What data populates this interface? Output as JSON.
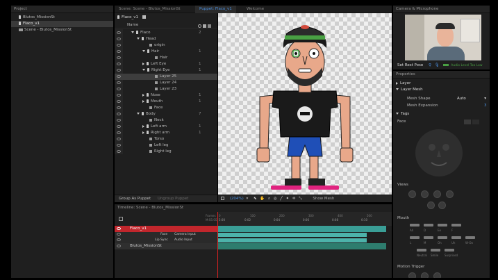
{
  "project": {
    "title": "Project",
    "items": [
      {
        "label": "Blutos_MissionSt"
      },
      {
        "label": "Flaco_v1"
      },
      {
        "label": "Scene - Blutos_MissionSt"
      }
    ]
  },
  "tabs": [
    {
      "label": "Scene: Scene - Blutos_MissionSt"
    },
    {
      "label": "Puppet: Flaco_v1"
    },
    {
      "label": "Welcome"
    }
  ],
  "puppet": {
    "name": "Flaco_v1",
    "column_name": "Name",
    "rows": [
      {
        "label": "Flaco",
        "num": "2"
      },
      {
        "label": "Head",
        "num": ""
      },
      {
        "label": "origin",
        "num": ""
      },
      {
        "label": "Hair",
        "num": "1"
      },
      {
        "label": "Hair",
        "num": ""
      },
      {
        "label": "Left Eye",
        "num": "1"
      },
      {
        "label": "Right Eye",
        "num": "1"
      },
      {
        "label": "Layer 25",
        "num": ""
      },
      {
        "label": "Layer 24",
        "num": ""
      },
      {
        "label": "Layer 23",
        "num": ""
      },
      {
        "label": "Nose",
        "num": "1"
      },
      {
        "label": "Mouth",
        "num": "1"
      },
      {
        "label": "Face",
        "num": ""
      },
      {
        "label": "Body",
        "num": "7"
      },
      {
        "label": "Neck",
        "num": ""
      },
      {
        "label": "Left arm",
        "num": "1"
      },
      {
        "label": "Right arm",
        "num": "1"
      },
      {
        "label": "Torso",
        "num": ""
      },
      {
        "label": "Left leg",
        "num": ""
      },
      {
        "label": "Right leg",
        "num": ""
      }
    ],
    "group_btn": "Group As Puppet",
    "ungroup_btn": "Ungroup Puppet",
    "zoom": "(204%)",
    "show_mesh": "Show Mesh"
  },
  "camera": {
    "title": "Camera & Microphone",
    "rest_pose": "Set Rest Pose",
    "audio_label": "Audio Level Too Low"
  },
  "properties": {
    "title": "Properties",
    "layer": "Layer",
    "layer_mesh": "Layer Mesh",
    "mesh_shape_label": "Mesh Shape",
    "mesh_shape_value": "Auto",
    "mesh_expansion_label": "Mesh Expansion",
    "mesh_expansion_value": "3",
    "tags": "Tags",
    "face": "Face",
    "views": "Views",
    "mouth": "Mouth",
    "mouth_labels": [
      "Ah",
      "D",
      "Ee",
      "F",
      "L",
      "M",
      "Oh",
      "Uh",
      "W-Oo",
      "Neutral",
      "Smile",
      "Surprised"
    ],
    "motion_trigger": "Motion Trigger"
  },
  "timeline": {
    "title": "Timeline: Scene - Blutos_MissionSt",
    "frames_label": "Frames",
    "time_label": "M:SS:SS",
    "ticks": [
      "5:00",
      "0:02",
      "0:04",
      "0:06",
      "0:08",
      "0:10"
    ],
    "tick_nums": [
      "0",
      "100",
      "200",
      "300",
      "400",
      "500"
    ],
    "tracks": [
      {
        "label": "Flaco_v1"
      },
      {
        "label": "Face",
        "input": "Camera Input"
      },
      {
        "label": "Lip Sync",
        "input": "Audio Input"
      },
      {
        "label": "Blutos_MissionSt"
      }
    ]
  },
  "colors": {
    "accent": "#4a90e2",
    "track_red": "#c1262c",
    "track_teal": "#3a9e96",
    "tag_green": "#49a043"
  }
}
